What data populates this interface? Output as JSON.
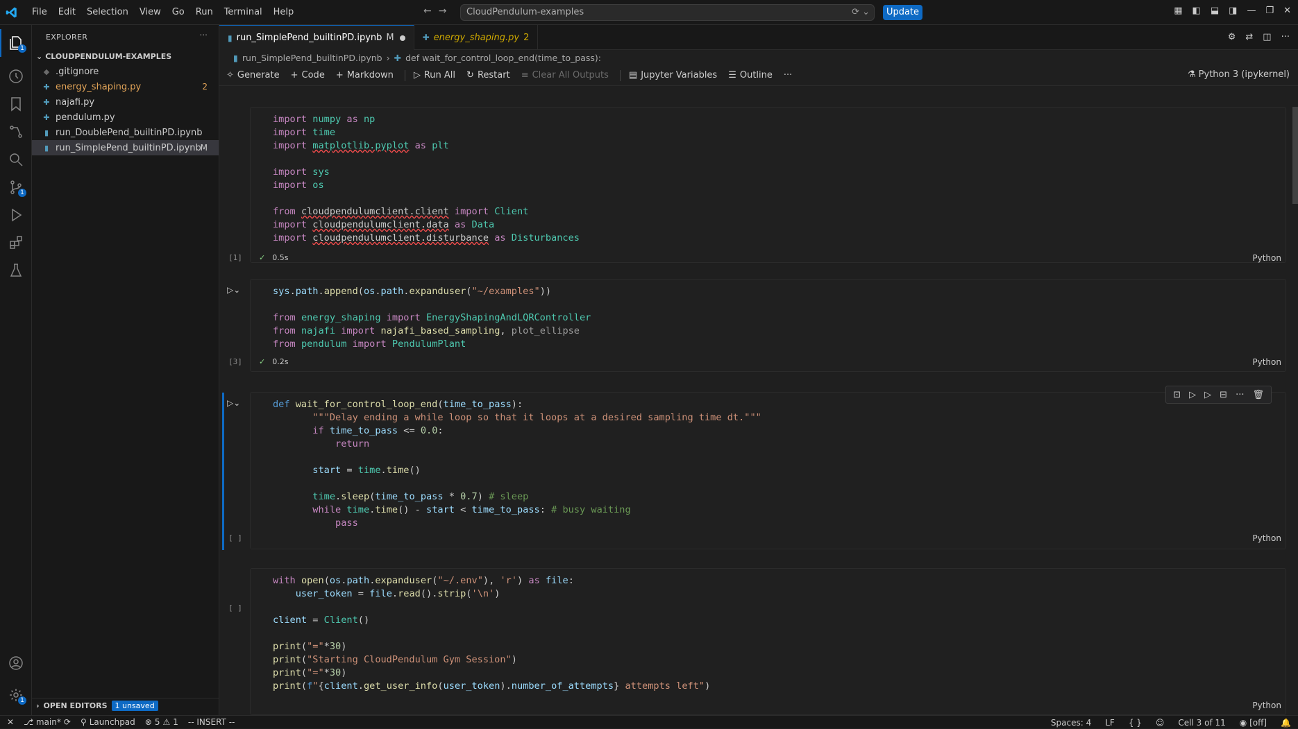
{
  "menu": [
    "File",
    "Edit",
    "Selection",
    "View",
    "Go",
    "Run",
    "Terminal",
    "Help"
  ],
  "command_center": "CloudPendulum-examples",
  "update_label": "Update",
  "explorer": {
    "title": "EXPLORER",
    "folder": "CLOUDPENDULUM-EXAMPLES",
    "files": [
      {
        "name": ".gitignore",
        "badge": ""
      },
      {
        "name": "energy_shaping.py",
        "badge": "2"
      },
      {
        "name": "najafi.py",
        "badge": ""
      },
      {
        "name": "pendulum.py",
        "badge": ""
      },
      {
        "name": "run_DoublePend_builtinPD.ipynb",
        "badge": ""
      },
      {
        "name": "run_SimplePend_builtinPD.ipynb",
        "badge": "M"
      }
    ],
    "open_editors": "OPEN EDITORS",
    "unsaved": "1 unsaved"
  },
  "tabs": [
    {
      "label": "run_SimplePend_builtinPD.ipynb",
      "mark": "M"
    },
    {
      "label": "energy_shaping.py",
      "mark": "2"
    }
  ],
  "breadcrumb": {
    "file": "run_SimplePend_builtinPD.ipynb",
    "symbol": "def wait_for_control_loop_end(time_to_pass):"
  },
  "toolbar": {
    "generate": "Generate",
    "code": "Code",
    "markdown": "Markdown",
    "run_all": "Run All",
    "restart": "Restart",
    "clear": "Clear All Outputs",
    "variables": "Jupyter Variables",
    "outline": "Outline",
    "kernel": "Python 3 (ipykernel)"
  },
  "cells": [
    {
      "exec": "[1]",
      "time": "0.5s",
      "lang": "Python"
    },
    {
      "exec": "[3]",
      "time": "0.2s",
      "lang": "Python"
    },
    {
      "exec": "[ ]",
      "lang": "Python"
    },
    {
      "exec": "[ ]",
      "lang": "Python"
    }
  ],
  "statusbar": {
    "branch": "main*",
    "launchpad": "Launchpad",
    "errors": "5",
    "warnings": "1",
    "mode": "-- INSERT --",
    "spaces": "Spaces: 4",
    "eol": "LF",
    "braces": "{ }",
    "cell": "Cell 3 of 11",
    "off": "[off]"
  }
}
